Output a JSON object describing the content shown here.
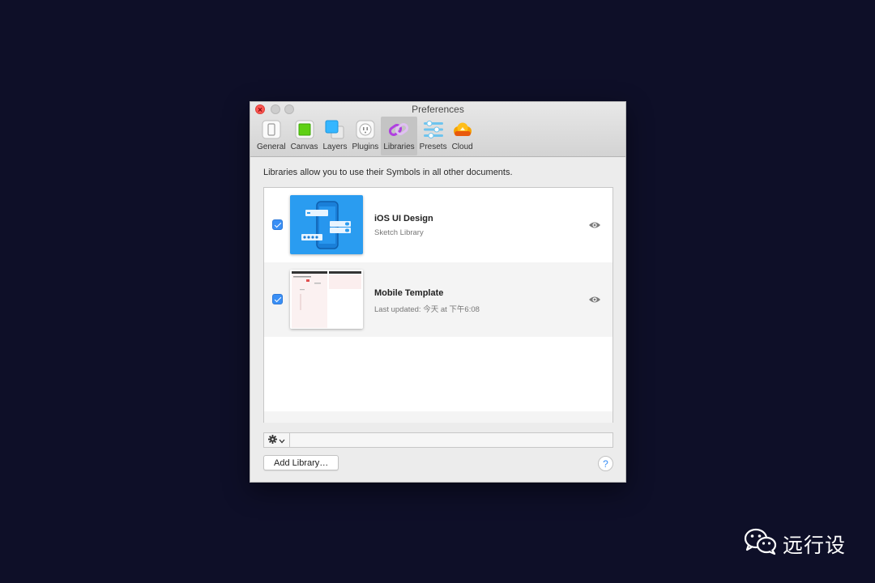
{
  "window": {
    "title": "Preferences"
  },
  "toolbar": {
    "items": [
      {
        "label": "General",
        "icon": "general-icon"
      },
      {
        "label": "Canvas",
        "icon": "canvas-icon"
      },
      {
        "label": "Layers",
        "icon": "layers-icon"
      },
      {
        "label": "Plugins",
        "icon": "plugins-icon"
      },
      {
        "label": "Libraries",
        "icon": "libraries-icon",
        "active": true
      },
      {
        "label": "Presets",
        "icon": "presets-icon"
      },
      {
        "label": "Cloud",
        "icon": "cloud-icon"
      }
    ]
  },
  "libraries": {
    "description": "Libraries allow you to use their Symbols in all other documents.",
    "items": [
      {
        "name": "iOS UI Design",
        "subtitle": "Sketch Library",
        "checked": true
      },
      {
        "name": "Mobile Template",
        "subtitle": "Last updated: 今天 at 下午6:08",
        "checked": true
      }
    ],
    "add_button": "Add Library…",
    "help_button": "?"
  },
  "colors": {
    "accent": "#3a8ff5",
    "background": "#0e0f28"
  },
  "watermark": {
    "text": "远行设"
  }
}
